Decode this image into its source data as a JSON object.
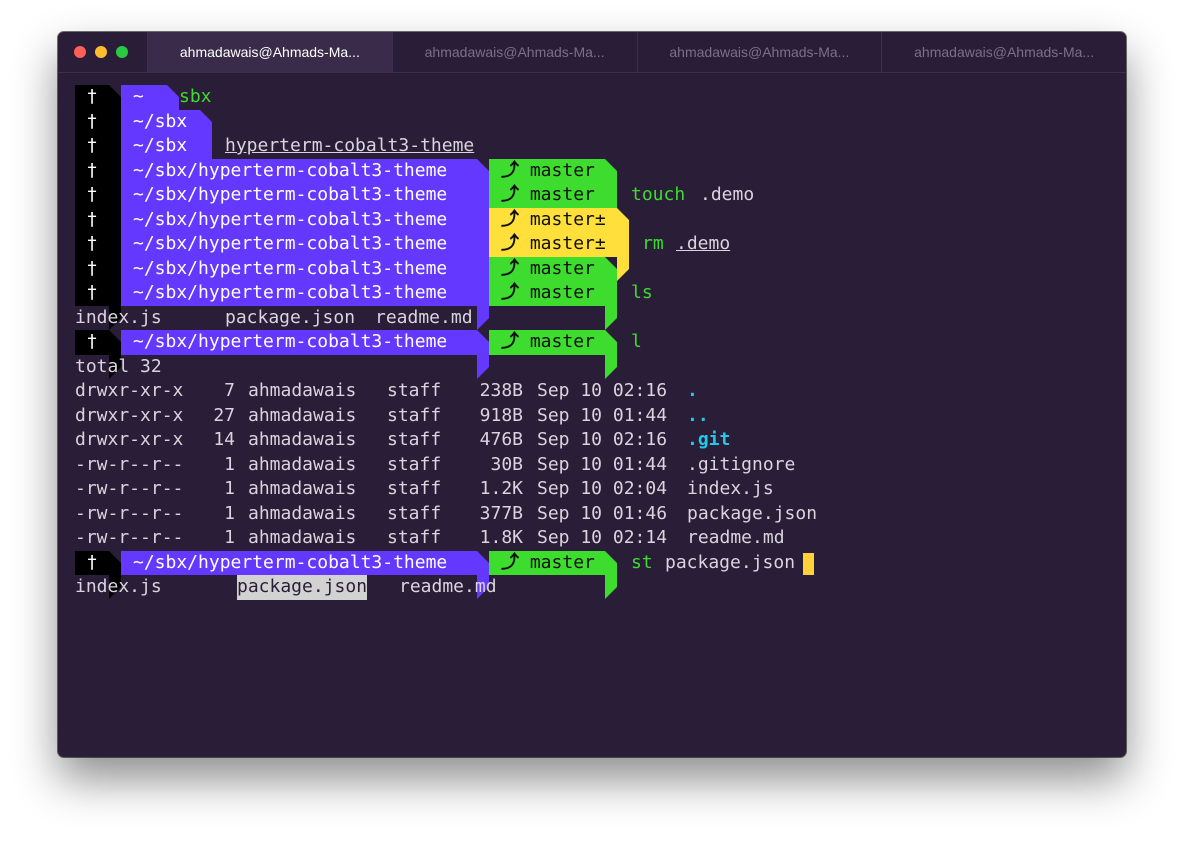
{
  "tabs": [
    "ahmadawais@Ahmads-Ma...",
    "ahmadawais@Ahmads-Ma...",
    "ahmadawais@Ahmads-Ma...",
    "ahmadawais@Ahmads-Ma..."
  ],
  "prompt": {
    "cross": "†",
    "home": "~",
    "sbx": "~/sbx",
    "repo_path": "~/sbx/hyperterm-cobalt3-theme",
    "branch_clean": "master",
    "branch_dirty": "master±",
    "branch_glyph": "⤴"
  },
  "commands": {
    "sbx": "sbx",
    "cd_repo_arg": "hyperterm-cobalt3-theme",
    "touch_cmd": "touch",
    "touch_arg": ".demo",
    "rm_cmd": "rm",
    "rm_arg": ".demo",
    "ls_cmd": "ls",
    "l_cmd": "l",
    "st_cmd": "st",
    "st_arg": "package.json"
  },
  "ls_output": {
    "col1": "index.js",
    "col2": "package.json",
    "col3": "readme.md"
  },
  "ll_total": "total 32",
  "ll_rows": [
    {
      "perm": "drwxr-xr-x",
      "links": "7",
      "owner": "ahmadawais",
      "group": "staff",
      "size": "238B",
      "date": "Sep 10 02:16",
      "name": "."
    },
    {
      "perm": "drwxr-xr-x",
      "links": "27",
      "owner": "ahmadawais",
      "group": "staff",
      "size": "918B",
      "date": "Sep 10 01:44",
      "name": ".."
    },
    {
      "perm": "drwxr-xr-x",
      "links": "14",
      "owner": "ahmadawais",
      "group": "staff",
      "size": "476B",
      "date": "Sep 10 02:16",
      "name": ".git"
    },
    {
      "perm": "-rw-r--r--",
      "links": "1",
      "owner": "ahmadawais",
      "group": "staff",
      "size": "30B",
      "date": "Sep 10 01:44",
      "name": ".gitignore"
    },
    {
      "perm": "-rw-r--r--",
      "links": "1",
      "owner": "ahmadawais",
      "group": "staff",
      "size": "1.2K",
      "date": "Sep 10 02:04",
      "name": "index.js"
    },
    {
      "perm": "-rw-r--r--",
      "links": "1",
      "owner": "ahmadawais",
      "group": "staff",
      "size": "377B",
      "date": "Sep 10 01:46",
      "name": "package.json"
    },
    {
      "perm": "-rw-r--r--",
      "links": "1",
      "owner": "ahmadawais",
      "group": "staff",
      "size": "1.8K",
      "date": "Sep 10 02:14",
      "name": "readme.md"
    }
  ],
  "final_output": {
    "col1": "index.js",
    "col2": "package.json",
    "col3": "readme.md"
  },
  "colors": {
    "background": "#2a1d37",
    "path_segment": "#6438ff",
    "branch_clean": "#3ddc2e",
    "branch_dirty": "#ffe03a",
    "command": "#3ddc2e",
    "directory": "#23c7e8",
    "cursor": "#ffd23a"
  },
  "icons": [
    "close-dot",
    "minimize-dot",
    "zoom-dot",
    "cross-icon",
    "git-branch-icon"
  ]
}
